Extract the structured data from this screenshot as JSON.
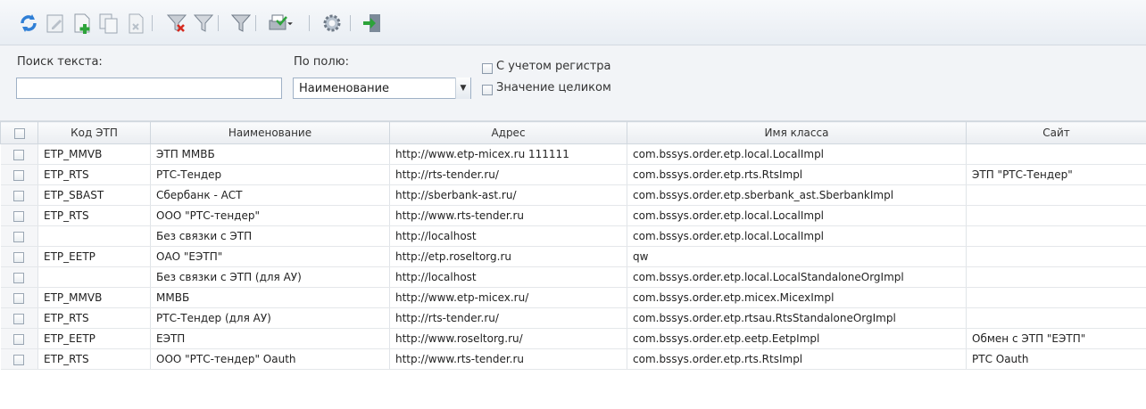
{
  "search": {
    "text_label": "Поиск текста:",
    "text_value": "",
    "field_label": "По полю:",
    "field_value": "Наименование",
    "case_label": "С учетом регистра",
    "whole_label": "Значение целиком"
  },
  "grid": {
    "columns": [
      "Код ЭТП",
      "Наименование",
      "Адрес",
      "Имя класса",
      "Сайт"
    ],
    "rows": [
      [
        "ETP_MMVB",
        "ЭТП ММВБ",
        "http://www.etp-micex.ru 111111",
        "com.bssys.order.etp.local.LocalImpl",
        ""
      ],
      [
        "ETP_RTS",
        "РТС-Тендер",
        "http://rts-tender.ru/",
        "com.bssys.order.etp.rts.RtsImpl",
        "ЭТП \"РТС-Тендер\""
      ],
      [
        "ETP_SBAST",
        "Сбербанк - АСТ",
        "http://sberbank-ast.ru/",
        "com.bssys.order.etp.sberbank_ast.SberbankImpl",
        ""
      ],
      [
        "ETP_RTS",
        "ООО \"РТС-тендер\"",
        "http://www.rts-tender.ru",
        "com.bssys.order.etp.local.LocalImpl",
        ""
      ],
      [
        "",
        "Без связки с ЭТП",
        "http://localhost",
        "com.bssys.order.etp.local.LocalImpl",
        ""
      ],
      [
        "ETP_EETP",
        "ОАО \"ЕЭТП\"",
        "http://etp.roseltorg.ru",
        "qw",
        ""
      ],
      [
        "",
        "Без связки с ЭТП (для АУ)",
        "http://localhost",
        "com.bssys.order.etp.local.LocalStandaloneOrgImpl",
        ""
      ],
      [
        "ETP_MMVB",
        "ММВБ",
        "http://www.etp-micex.ru/",
        "com.bssys.order.etp.micex.MicexImpl",
        ""
      ],
      [
        "ETP_RTS",
        "РТС-Тендер (для АУ)",
        "http://rts-tender.ru/",
        "com.bssys.order.etp.rtsau.RtsStandaloneOrgImpl",
        ""
      ],
      [
        "ETP_EETP",
        "ЕЭТП",
        "http://www.roseltorg.ru/",
        "com.bssys.order.etp.eetp.EetpImpl",
        "Обмен с ЭТП \"ЕЭТП\""
      ],
      [
        "ETP_RTS",
        "ООО \"РТС-тендер\" Oauth",
        "http://www.rts-tender.ru",
        "com.bssys.order.etp.rts.RtsImpl",
        "РТС Oauth"
      ]
    ]
  }
}
